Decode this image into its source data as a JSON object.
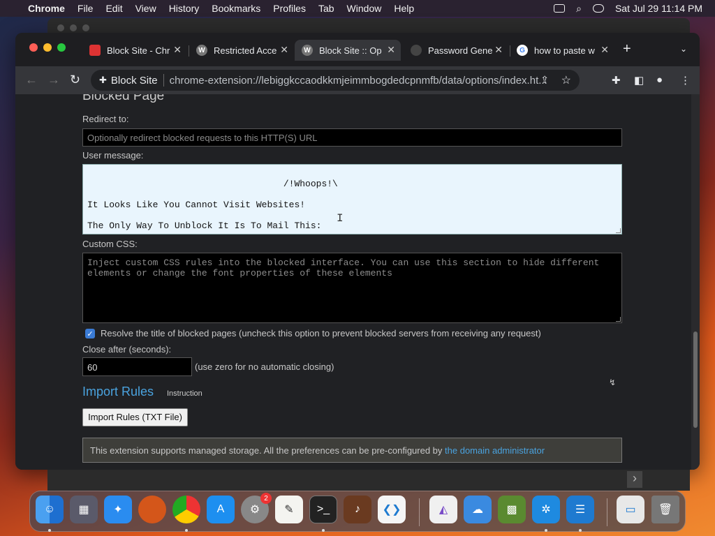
{
  "menubar": {
    "app": "Chrome",
    "items": [
      "File",
      "Edit",
      "View",
      "History",
      "Bookmarks",
      "Profiles",
      "Tab",
      "Window",
      "Help"
    ],
    "datetime": "Sat Jul 29  11:14 PM"
  },
  "tabs": [
    {
      "title": "Block Site - Chr",
      "favicon": "gift-icon",
      "active": false
    },
    {
      "title": "Restricted Acce",
      "favicon": "W",
      "active": false
    },
    {
      "title": "Block Site :: Op",
      "favicon": "W",
      "active": true
    },
    {
      "title": "Password Gene",
      "favicon": "lock-icon",
      "active": false
    },
    {
      "title": "how to paste w",
      "favicon": "G",
      "active": false
    }
  ],
  "toolbar": {
    "ext_name": "Block Site",
    "url": "chrome-extension://lebiggkccaodkkmjeimmbogdedcpnmfb/data/options/index.ht..."
  },
  "page": {
    "blocked_heading": "Blocked Page",
    "redirect_label": "Redirect to:",
    "redirect_placeholder": "Optionally redirect blocked requests to this HTTP(S) URL",
    "message_label": "User message:",
    "message_text": "                                 /!Whoops!\\\n\nIt Looks Like You Cannot Visit Websites!\n\nThe Only Way To Unblock It Is To Mail This:",
    "css_label": "Custom CSS:",
    "css_placeholder": "Inject custom CSS rules into the blocked interface. You can use this section to hide different elements or change the font properties of these elements",
    "resolve_label": "Resolve the title of blocked pages (uncheck this option to prevent blocked servers from receiving any request)",
    "resolve_checked": true,
    "close_label": "Close after (seconds):",
    "close_value": "60",
    "close_hint": "(use zero for no automatic closing)",
    "import_heading": "Import Rules",
    "instruction": "Instruction",
    "import_button": "Import Rules (TXT File)",
    "notice_text": "This extension supports managed storage. All the preferences can be pre-configured by ",
    "notice_link": "the domain administrator"
  },
  "dock": {
    "badge_count": "2"
  }
}
